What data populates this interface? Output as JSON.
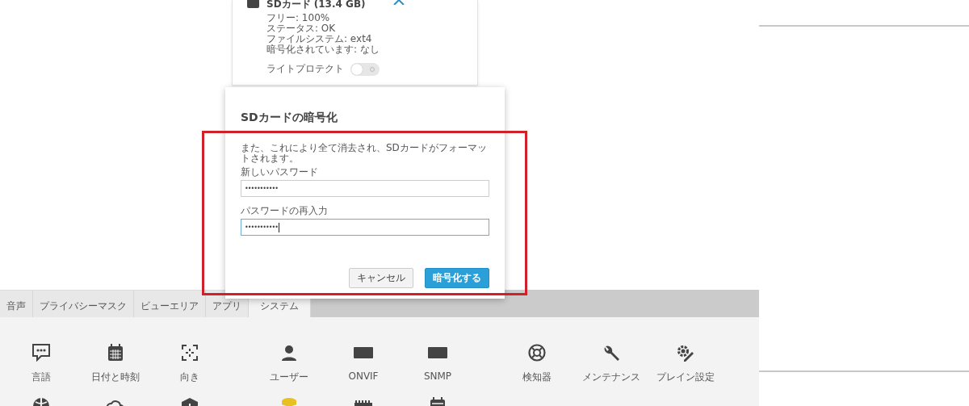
{
  "sd_card": {
    "title": "SDカード (13.4 GB)",
    "details": [
      "フリー: 100%",
      "ステータス: OK",
      "ファイルシステム: ext4",
      "暗号化されています: なし"
    ],
    "write_protect": {
      "label": "ライトプロテクト",
      "on": false
    }
  },
  "tabs": [
    {
      "label": "音声",
      "selected": false
    },
    {
      "label": "プライバシーマスク",
      "selected": false
    },
    {
      "label": "ビューエリア",
      "selected": false
    },
    {
      "label": "アプリ",
      "selected": false
    },
    {
      "label": "システム",
      "selected": true
    }
  ],
  "system_items": [
    {
      "label": "言語",
      "kind": "chat"
    },
    {
      "label": "日付と時刻",
      "kind": "calendar"
    },
    {
      "label": "向き",
      "kind": "frame"
    },
    {
      "label": "ユーザー",
      "kind": "user"
    },
    {
      "label": "ONVIF",
      "kind": "tag"
    },
    {
      "label": "SNMP",
      "kind": "tag"
    },
    {
      "label": "検知器",
      "kind": "wheel"
    },
    {
      "label": "メンテナンス",
      "kind": "wrench"
    },
    {
      "label": "プレイン設定",
      "kind": "gear"
    }
  ],
  "more_items": [
    {
      "kind": "globe"
    },
    {
      "kind": "cloud"
    },
    {
      "kind": "box"
    },
    {
      "kind": "database"
    },
    {
      "kind": "ports"
    },
    {
      "kind": "calendar"
    }
  ],
  "dialog": {
    "title": "SDカードの暗号化",
    "message": "また、これにより全て消去され、SDカードがフォーマットされます。",
    "fields": [
      {
        "label": "新しいパスワード",
        "value": "•••••••••••",
        "focused": false
      },
      {
        "label": "パスワードの再入力",
        "value": "•••••••••••",
        "focused": true
      }
    ],
    "buttons": [
      {
        "label": "キャンセル",
        "kind": "secondary"
      },
      {
        "label": "暗号化する",
        "kind": "primary"
      }
    ]
  }
}
